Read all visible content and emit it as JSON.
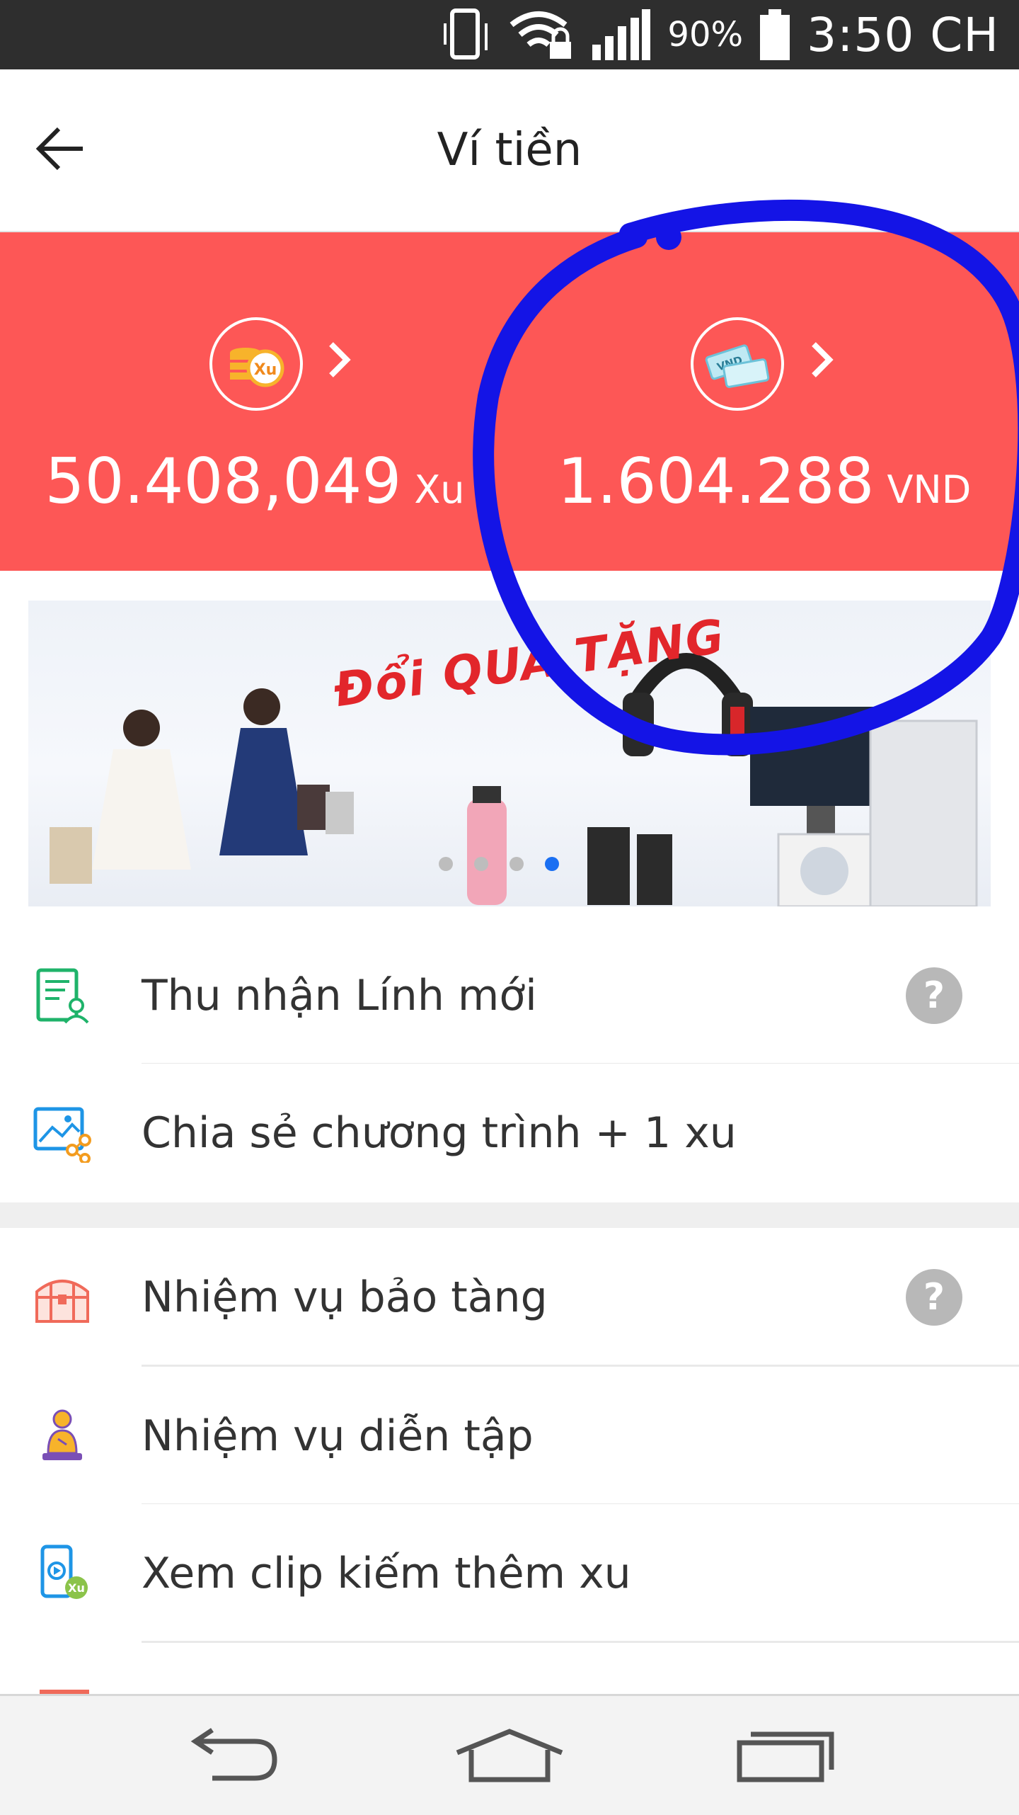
{
  "status_bar": {
    "battery_percent": "90%",
    "time": "3:50 CH",
    "icons": [
      "vibrate-icon",
      "wifi-lock-icon",
      "signal-icon",
      "battery-icon"
    ]
  },
  "app_bar": {
    "title": "Ví tiền"
  },
  "wallet": {
    "xu": {
      "icon_text": "Xu",
      "amount": "50.408,049",
      "unit": "Xu"
    },
    "vnd": {
      "icon_text": "VND",
      "amount": "1.604.288",
      "unit": "VND"
    },
    "background_color": "#fd5756"
  },
  "banner": {
    "title": "Đổi QUÀ TẶNG",
    "dots_total": 4,
    "active_dot": 4
  },
  "list": {
    "items": [
      {
        "label": "Thu nhận Lính mới",
        "icon": "newcomer-doc-icon",
        "has_help": true
      },
      {
        "label": "Chia sẻ chương trình + 1 xu",
        "icon": "share-image-icon",
        "has_help": false
      },
      {
        "label": "Nhiệm vụ bảo tàng",
        "icon": "treasure-chest-icon",
        "has_help": true
      },
      {
        "label": "Nhiệm vụ diễn tập",
        "icon": "drill-person-icon",
        "has_help": false
      },
      {
        "label": "Xem clip kiếm thêm xu",
        "icon": "video-xu-icon",
        "has_help": false
      }
    ],
    "help_symbol": "?"
  },
  "annotation": {
    "color": "#1414e6"
  },
  "nav_bar": {
    "buttons": [
      "back-nav-icon",
      "home-nav-icon",
      "recents-nav-icon"
    ]
  }
}
